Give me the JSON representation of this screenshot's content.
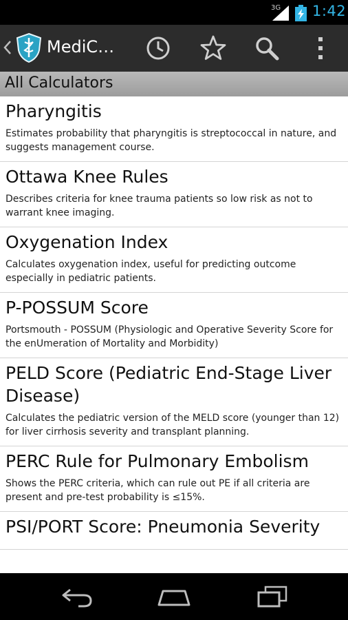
{
  "status_bar": {
    "network": "3G",
    "time": "1:42",
    "icons": [
      "signal-icon",
      "battery-charging-icon"
    ]
  },
  "action_bar": {
    "title": "MediC…",
    "icons": [
      "back-chevron-icon",
      "app-logo-icon",
      "history-clock-icon",
      "favorites-star-icon",
      "search-icon",
      "overflow-menu-icon"
    ]
  },
  "section_header": "All Calculators",
  "items": [
    {
      "title": "Pharyngitis",
      "description": "Estimates probability that pharyngitis is streptococcal in nature, and suggests management course."
    },
    {
      "title": "Ottawa Knee Rules",
      "description": "Describes criteria for knee trauma patients so low risk as not to warrant knee imaging."
    },
    {
      "title": "Oxygenation Index",
      "description": "Calculates oxygenation index, useful for predicting outcome especially in pediatric patients."
    },
    {
      "title": "P-POSSUM Score",
      "description": "Portsmouth - POSSUM (Physiologic and Operative Severity Score for the enUmeration of Mortality and Morbidity)"
    },
    {
      "title": "PELD Score (Pediatric End-Stage Liver Disease)",
      "description": "Calculates the pediatric version of the MELD score (younger than 12) for liver cirrhosis severity and transplant planning."
    },
    {
      "title": "PERC Rule for Pulmonary Embolism",
      "description": "Shows the PERC criteria, which can rule out PE if all criteria are present and pre-test probability is ≤15%."
    },
    {
      "title": "PSI/PORT Score: Pneumonia Severity",
      "description": ""
    }
  ],
  "nav_bar": {
    "icons": [
      "nav-back-icon",
      "nav-home-icon",
      "nav-recent-apps-icon"
    ]
  },
  "colors": {
    "accent": "#33b5e5",
    "action_bar": "#2c2c2c",
    "section_header": "#a8a8a8",
    "logo": "#2aa3c4"
  }
}
